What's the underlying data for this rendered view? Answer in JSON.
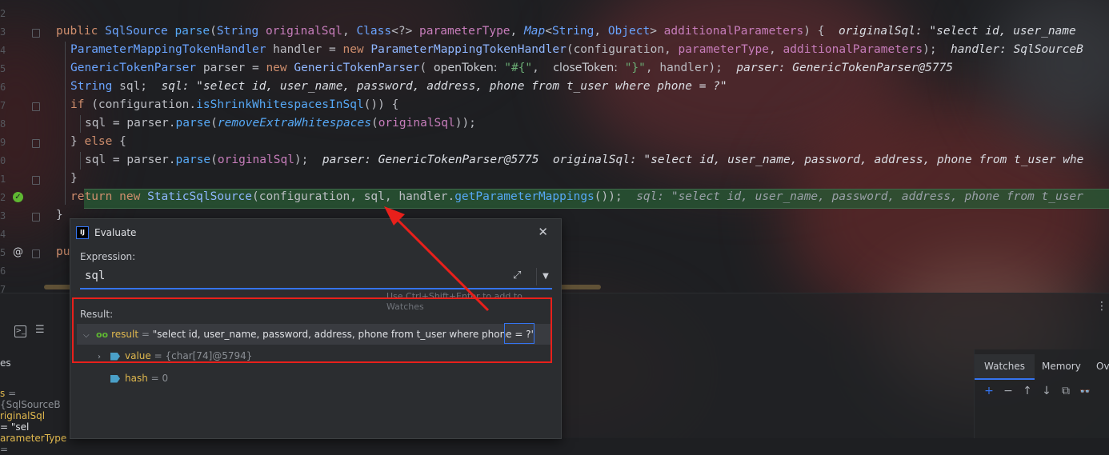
{
  "gutter": {
    "line_numbers": [
      "2",
      "3",
      "4",
      "5",
      "6",
      "7",
      "8",
      "9",
      "0",
      "1",
      "2",
      "3",
      "4",
      "5",
      "6",
      "7"
    ]
  },
  "code": {
    "line1": {
      "kw_public": "public",
      "type_return": "SqlSource",
      "fn_name": "parse",
      "open": "(",
      "t1": "String",
      "p1": "originalSql",
      "c1": ", ",
      "t2": "Class",
      "g2": "<?>",
      "p2": "parameterType",
      "c2": ", ",
      "t3": "Map",
      "g3a": "<",
      "t3a": "String",
      "g3b": ", ",
      "t3b": "Object",
      "g3c": ">",
      "p3": "additionalParameters",
      "close": ") {  ",
      "ann": "originalSql: \"select id, user_name"
    },
    "line2": {
      "type": "ParameterMappingTokenHandler",
      "var": " handler = ",
      "kw_new": "new",
      "cls": "ParameterMappingTokenHandler",
      "args_open": "(configuration, ",
      "a1": "parameterType",
      "a2sep": ", ",
      "a2": "additionalParameters",
      "end": ");  ",
      "ann": "handler: SqlSourceB"
    },
    "line3": {
      "type": "GenericTokenParser",
      "var": " parser = ",
      "kw_new": "new",
      "cls": "GenericTokenParser",
      "open": "( ",
      "hint1": "openToken:",
      "s1": "\"#{\"",
      "sep": ",  ",
      "hint2": "closeToken:",
      "s2": "\"}\"",
      "end": ", handler);  ",
      "ann": "parser: GenericTokenParser@5775"
    },
    "line4": {
      "type": "String",
      "var": " sql;  ",
      "ann": "sql: \"select id, user_name, password, address, phone from t_user where phone = ?\""
    },
    "line5": {
      "kw_if": "if",
      "open": " (configuration.",
      "fn": "isShrinkWhitespacesInSql",
      "end": "()) {"
    },
    "line6": {
      "lhs": "sql = parser.",
      "fn": "parse",
      "open": "(",
      "fn2": "removeExtraWhitespaces",
      "open2": "(",
      "p": "originalSql",
      "end": "));"
    },
    "line7": {
      "pre": "} ",
      "kw_else": "else",
      "post": " {"
    },
    "line8": {
      "lhs": "sql = parser.",
      "fn": "parse",
      "open": "(",
      "p": "originalSql",
      "end": ");  ",
      "ann": "parser: GenericTokenParser@5775  originalSql: \"select id, user_name, password, address, phone from t_user whe"
    },
    "line9": {
      "text": "}"
    },
    "line10": {
      "kw_return": "return",
      "sp": " ",
      "kw_new": "new",
      "cls": "StaticSqlSource",
      "args": "(configuration, sql, handler.",
      "fn": "getParameterMappings",
      "end": "());  ",
      "ann": "sql: \"select id, user_name, password, address, phone from t_user"
    },
    "line11": {
      "text": "}"
    },
    "line12": {
      "kw": "pu"
    }
  },
  "evaluate_dialog": {
    "title": "Evaluate",
    "logo": "IJ",
    "close": "✕",
    "expression_label": "Expression:",
    "expression_value": "sql",
    "expand_icon": "⤢",
    "dropdown_icon": "▼",
    "hint": "Use Ctrl+Shift+Enter to add to Watches",
    "result_label": "Result:",
    "result_name": "result",
    "result_eq": " = ",
    "result_value": "\"select id, user_name, password, address, phone from t_user where phone = ?\"",
    "value_name": "value",
    "value_value": "{char[74]@5794}",
    "hash_name": "hash",
    "hash_value": "0"
  },
  "debug_panel": {
    "kebab": "⋮",
    "variables_partial": [
      {
        "name": "es",
        "value": ""
      },
      {
        "name": "s",
        "value": "= {SqlSourceB"
      },
      {
        "name": "riginalSql",
        "value": "= \"sel"
      },
      {
        "name": "arameterType",
        "value": "="
      }
    ],
    "watches_tabs": [
      "Watches",
      "Memory",
      "Ov"
    ],
    "watches_tools": [
      "+",
      "−",
      "↑",
      "↓",
      "⧉",
      "👓"
    ]
  },
  "colors": {
    "accent": "#3574f0",
    "annotation_red": "#e8201b",
    "success_green": "#5fb832"
  }
}
